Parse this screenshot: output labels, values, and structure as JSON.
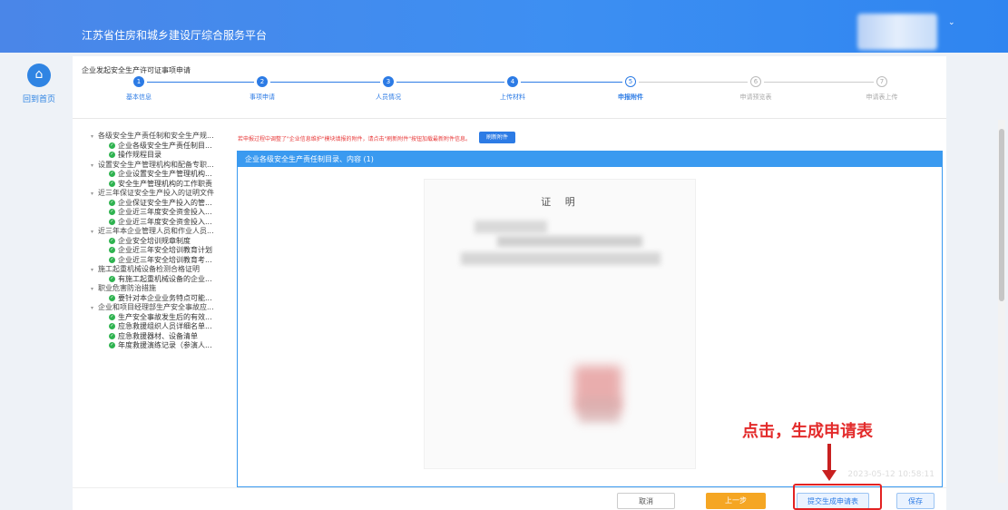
{
  "header": {
    "title": "江苏省住房和城乡建设厅综合服务平台",
    "user_caret": "⌄"
  },
  "home": {
    "icon": "home-icon",
    "label": "回到首页"
  },
  "app": {
    "name": "企业发起安全生产许可证事项申请"
  },
  "steps": [
    {
      "num": "1",
      "label": "基本信息",
      "state": "done"
    },
    {
      "num": "2",
      "label": "事项申请",
      "state": "done"
    },
    {
      "num": "3",
      "label": "人员情况",
      "state": "done"
    },
    {
      "num": "4",
      "label": "上传材料",
      "state": "done"
    },
    {
      "num": "5",
      "label": "申报附件",
      "state": "current"
    },
    {
      "num": "6",
      "label": "申请预览表",
      "state": "todo"
    },
    {
      "num": "7",
      "label": "申请表上传",
      "state": "todo"
    }
  ],
  "tree": [
    {
      "type": "group",
      "label": "各级安全生产责任制和安全生产规..."
    },
    {
      "type": "leaf",
      "label": "企业各级安全生产责任制目..."
    },
    {
      "type": "leaf",
      "label": "操作规程目录"
    },
    {
      "type": "group",
      "label": "设置安全生产管理机构和配备专职..."
    },
    {
      "type": "leaf",
      "label": "企业设置安全生产管理机构..."
    },
    {
      "type": "leaf",
      "label": "安全生产管理机构的工作职责"
    },
    {
      "type": "group",
      "label": "近三年保证安全生产投入的证明文件"
    },
    {
      "type": "leaf",
      "label": "企业保证安全生产投入的管..."
    },
    {
      "type": "leaf",
      "label": "企业近三年度安全资金投入..."
    },
    {
      "type": "leaf",
      "label": "企业近三年度安全资金投入..."
    },
    {
      "type": "group",
      "label": "近三年本企业管理人员和作业人员..."
    },
    {
      "type": "leaf",
      "label": "企业安全培训规章制度"
    },
    {
      "type": "leaf",
      "label": "企业近三年安全培训教育计划"
    },
    {
      "type": "leaf",
      "label": "企业近三年安全培训教育考..."
    },
    {
      "type": "group",
      "label": "施工起重机械设备检测合格证明"
    },
    {
      "type": "leaf",
      "label": "有施工起重机械设备的企业..."
    },
    {
      "type": "group",
      "label": "职业危害防治措施"
    },
    {
      "type": "leaf",
      "label": "要针对本企业业务特点可能..."
    },
    {
      "type": "group",
      "label": "企业和项目经理部生产安全事故应..."
    },
    {
      "type": "leaf",
      "label": "生产安全事故发生后的有效..."
    },
    {
      "type": "leaf",
      "label": "应急救援组织人员详细名单..."
    },
    {
      "type": "leaf",
      "label": "应急救援器材、设备清单"
    },
    {
      "type": "leaf",
      "label": "年度救援演练记录（参演人..."
    }
  ],
  "notice": "若申报过程中调整了\"企业信息维护\"模块填报的附件，请点击\"刷新附件\"按钮加载最新附件信息。",
  "refresh_button": "刷新附件",
  "viewer": {
    "header": "企业各级安全生产责任制目录、内容 (1)",
    "doc_title": "证 明",
    "timestamp": "2023-05-12 10:58:11"
  },
  "annotation": "点击，生成申请表",
  "footer": {
    "cancel": "取消",
    "prev": "上一步",
    "submit": "提交生成申请表",
    "save": "保存"
  },
  "colors": {
    "primary": "#2c7be5",
    "accent_orange": "#f5a623",
    "annotation_red": "#e32b2b",
    "ok_green": "#2fb350"
  }
}
